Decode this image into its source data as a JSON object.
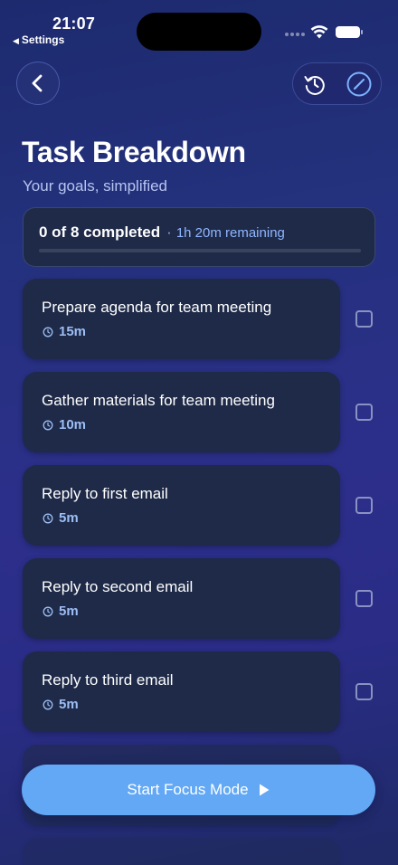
{
  "status_bar": {
    "time": "21:07",
    "back_app": "Settings"
  },
  "header": {
    "title": "Task Breakdown",
    "subtitle": "Your goals, simplified"
  },
  "progress": {
    "completed_text": "0 of 8 completed",
    "separator": "·",
    "remaining_text": "1h 20m remaining",
    "completed_fraction": 0
  },
  "tasks": [
    {
      "title": "Prepare agenda for team meeting",
      "duration": "15m",
      "checked": false
    },
    {
      "title": "Gather materials for team meeting",
      "duration": "10m",
      "checked": false
    },
    {
      "title": "Reply to first email",
      "duration": "5m",
      "checked": false
    },
    {
      "title": "Reply to second email",
      "duration": "5m",
      "checked": false
    },
    {
      "title": "Reply to third email",
      "duration": "5m",
      "checked": false
    }
  ],
  "start_button": {
    "label": "Start Focus Mode"
  },
  "icons": {
    "back": "chevron-left-icon",
    "reset": "reset-icon",
    "edit": "pencil-icon",
    "clock": "clock-icon",
    "play": "play-icon"
  },
  "colors": {
    "accent": "#62a8f5",
    "card": "#1e2a48",
    "duration": "#9dbef5"
  }
}
